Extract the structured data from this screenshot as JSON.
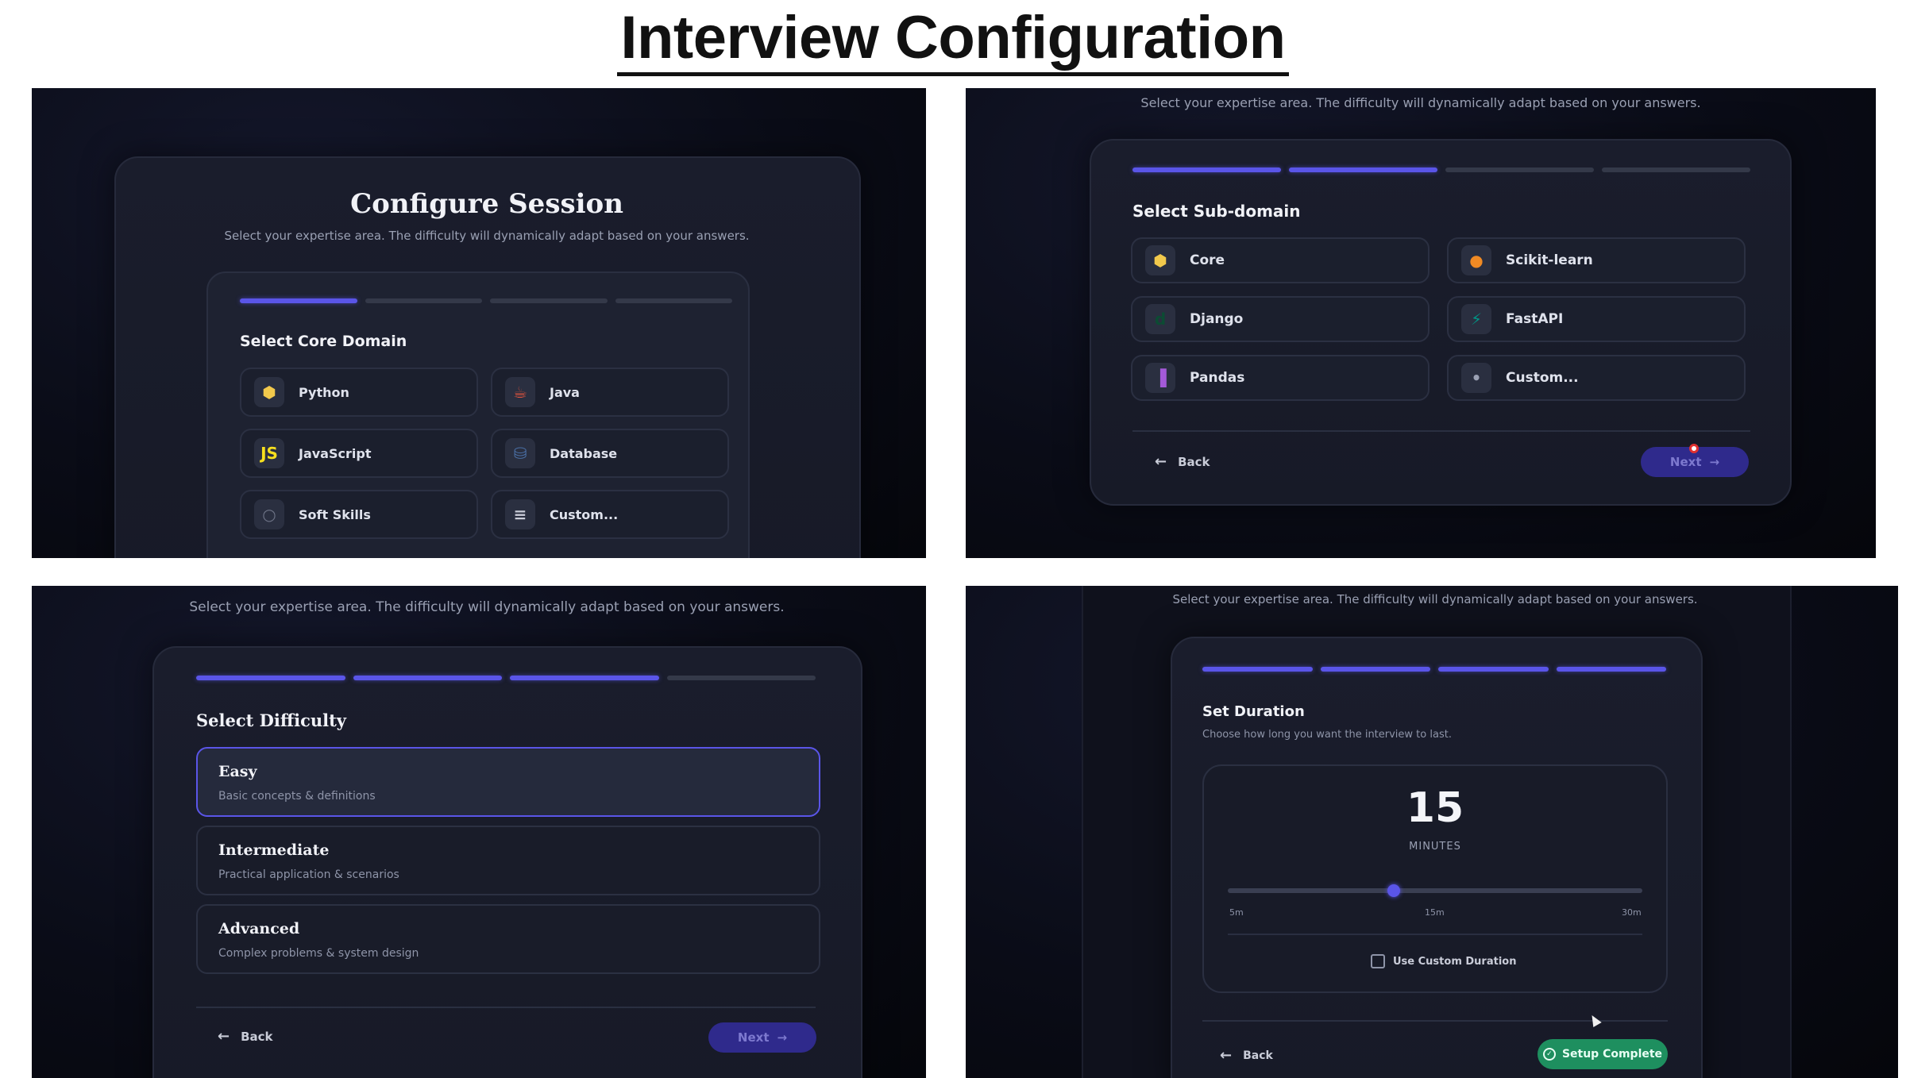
{
  "title": "Interview Configuration",
  "subtitle": "Select your expertise area. The difficulty will dynamically adapt based on your answers.",
  "panel1": {
    "heading": "Configure Session",
    "section": "Select Core Domain",
    "options": [
      {
        "label": "Python",
        "icon": "python-icon",
        "glyph": "⬢",
        "color": "#f2c94c"
      },
      {
        "label": "Java",
        "icon": "java-icon",
        "glyph": "☕",
        "color": "#e2533d"
      },
      {
        "label": "JavaScript",
        "icon": "javascript-icon",
        "glyph": "JS",
        "color": "#f7df1e"
      },
      {
        "label": "Database",
        "icon": "database-icon",
        "glyph": "⛁",
        "color": "#4a6fa5"
      },
      {
        "label": "Soft Skills",
        "icon": "soft-skills-icon",
        "glyph": "○",
        "color": "#6d7386"
      },
      {
        "label": "Custom...",
        "icon": "sliders-icon",
        "glyph": "≡",
        "color": "#c9ccd8"
      }
    ]
  },
  "panel2": {
    "section": "Select Sub-domain",
    "options": [
      {
        "label": "Core",
        "icon": "python-icon",
        "glyph": "⬢",
        "color": "#f2c94c"
      },
      {
        "label": "Scikit-learn",
        "icon": "scikit-learn-icon",
        "glyph": "●",
        "color": "#f08a24"
      },
      {
        "label": "Django",
        "icon": "django-icon",
        "glyph": "d",
        "color": "#0c4b33"
      },
      {
        "label": "FastAPI",
        "icon": "fastapi-icon",
        "glyph": "⚡",
        "color": "#009485"
      },
      {
        "label": "Pandas",
        "icon": "pandas-icon",
        "glyph": "▐",
        "color": "#a45ad8"
      },
      {
        "label": "Custom...",
        "icon": "dot-icon",
        "glyph": "•",
        "color": "#9aa0b3"
      }
    ],
    "back": "Back",
    "next": "Next"
  },
  "panel3": {
    "section": "Select Difficulty",
    "levels": [
      {
        "title": "Easy",
        "desc": "Basic concepts & definitions",
        "selected": true
      },
      {
        "title": "Intermediate",
        "desc": "Practical application & scenarios",
        "selected": false
      },
      {
        "title": "Advanced",
        "desc": "Complex problems & system design",
        "selected": false
      }
    ],
    "back": "Back",
    "next": "Next"
  },
  "panel4": {
    "section": "Set Duration",
    "helper": "Choose how long you want the interview to last.",
    "value": "15",
    "unit": "MINUTES",
    "slider": {
      "min_label": "5m",
      "mid_label": "15m",
      "max_label": "30m",
      "fraction": 0.4
    },
    "custom_label": "Use Custom Duration",
    "back": "Back",
    "complete": "Setup Complete"
  },
  "progress": {
    "panel1": 1,
    "panel2": 2,
    "panel3": 3,
    "panel4": 4,
    "total": 4
  },
  "colors": {
    "accent": "#5a55e8",
    "success": "#1e8f5f",
    "next_bg": "#2f2a8c"
  }
}
